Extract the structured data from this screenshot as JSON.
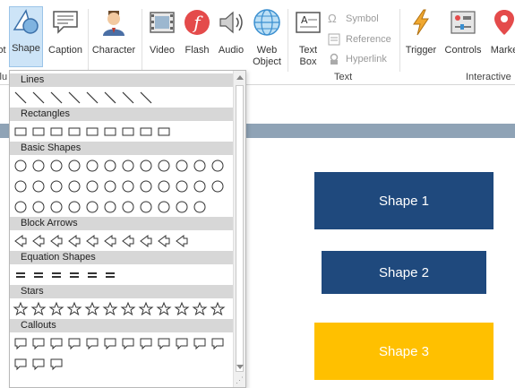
{
  "ribbon": {
    "buttons": [
      {
        "id": "ot",
        "label": "ot"
      },
      {
        "id": "shape",
        "label": "Shape"
      },
      {
        "id": "caption",
        "label": "Caption"
      },
      {
        "id": "character",
        "label": "Character"
      },
      {
        "id": "video",
        "label": "Video"
      },
      {
        "id": "flash",
        "label": "Flash"
      },
      {
        "id": "audio",
        "label": "Audio"
      },
      {
        "id": "web_object",
        "label": "Web Object"
      },
      {
        "id": "text_box",
        "label": "Text Box"
      },
      {
        "id": "trigger",
        "label": "Trigger"
      },
      {
        "id": "controls",
        "label": "Controls"
      },
      {
        "id": "marker",
        "label": "Marke"
      }
    ],
    "small_buttons": [
      {
        "label": "Symbol"
      },
      {
        "label": "Reference"
      },
      {
        "label": "Hyperlink"
      }
    ],
    "group_labels": {
      "illustrations": "Illu",
      "text": "Text",
      "interactive": "Interactive"
    }
  },
  "shapes_panel": {
    "categories": [
      {
        "name": "Lines",
        "rows": [
          8
        ]
      },
      {
        "name": "Rectangles",
        "rows": [
          9
        ]
      },
      {
        "name": "Basic Shapes",
        "rows": [
          12,
          12,
          11
        ]
      },
      {
        "name": "Block Arrows",
        "rows": [
          10
        ]
      },
      {
        "name": "Equation Shapes",
        "rows": [
          6
        ]
      },
      {
        "name": "Stars",
        "rows": [
          12
        ]
      },
      {
        "name": "Callouts",
        "rows": [
          12,
          3
        ]
      }
    ]
  },
  "slide": {
    "shapes": [
      {
        "label": "Shape 1",
        "color": "#1f497d"
      },
      {
        "label": "Shape 2",
        "color": "#1f497d"
      },
      {
        "label": "Shape 3",
        "color": "#ffc000"
      }
    ]
  },
  "colors": {
    "accent": "#1f497d",
    "highlight": "#cde4f7",
    "flash_red": "#e44b4b"
  }
}
